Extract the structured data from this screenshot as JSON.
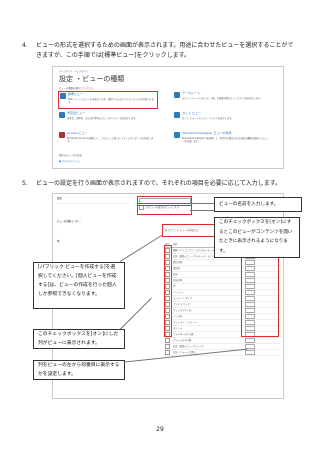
{
  "step4": {
    "number": "4.",
    "text": "ビューの形式を選択するための画面が表示されます。用途に合わせたビューを選択することができますが、この手順では[標準ビュー]をクリックします。"
  },
  "screenshot1": {
    "breadcrumb": "チームサイト　▸ このサイト",
    "title": "設定 ・ビューの種類",
    "subtitle": "ビューの種類を選択してください",
    "tiles": [
      {
        "title": "標準ビュー",
        "desc": "Web ページ上にデータを表示します。選択できるスタイルのリストから作成できます。"
      },
      {
        "title": "データシート",
        "desc": "スプレッドシートのように一括して編集可能なビューでデータを表示します。"
      },
      {
        "title": "予定表ビュー",
        "desc": "日単位、週単位、または月単位のカレンダーでデータを表示します。"
      },
      {
        "title": "ガント ビュー",
        "desc": "ガント チャートでリスト アイテムを表示します。"
      },
      {
        "title": "Access ビュー",
        "desc": "Microsoft Access を起動して、このビューに基づくフォームやレポートを作成します。"
      },
      {
        "title": "SharePoint Designer ビューの作成",
        "desc": "SharePoint Designer を起動して、条件付き書式などの高度な機能を使用したビューを作成します。"
      }
    ],
    "existing_label": "既存のビューから作成",
    "existing_item": "● すべてのアイテム"
  },
  "step5": {
    "number": "5.",
    "text": "ビューの設定を行う画面が表示されますので、それぞれの項目を必要に応じて入力します。"
  },
  "screenshot2": {
    "name_label": "名前",
    "audience_label": "ビューの対象ユーザー：",
    "public_option": "パブリック ビューを作成する",
    "default_option": "このビューを既定のビューにする",
    "columns_label": "列",
    "columns_header": [
      "表示",
      "列名",
      "左からの位置"
    ],
    "rows": [
      "種類（アイコンでリンクされたドキュメント）",
      "名前（編集メニューでドキュメントにリンク）",
      "更新日時",
      "更新者",
      "名前",
      "作成日時",
      "ID",
      "バージョン",
      "コンテンツ タイプ",
      "ファイル サイズ",
      "チェックアウト先",
      "ソース名",
      "チェックイン コメント",
      "タイトル",
      "フォルダーの子の数",
      "アイテムの子の数",
      "名前（編集メニューでリンク）",
      "名前（フォームで開く）"
    ]
  },
  "callouts": {
    "name": "ビューの名前を入力します。",
    "default_view": "このチェックボックスを[オン]にするとこのビューがコンテンツを開いたときに表示されるようになります。",
    "public_view": "[パブリック ビューを作成する]を選択してください。[個人ビューを作成する]は、ビューの作成を行った個人しか参照できなくなります。",
    "columns_check": "このチェックボックスを[オン]にした列がビューに表示されます。",
    "order": "列をビューの左から何番目に表示するかを設定します。"
  },
  "page_number": "29",
  "colors": {
    "accent": "#2b6cb0",
    "highlight": "#e32b2b"
  }
}
